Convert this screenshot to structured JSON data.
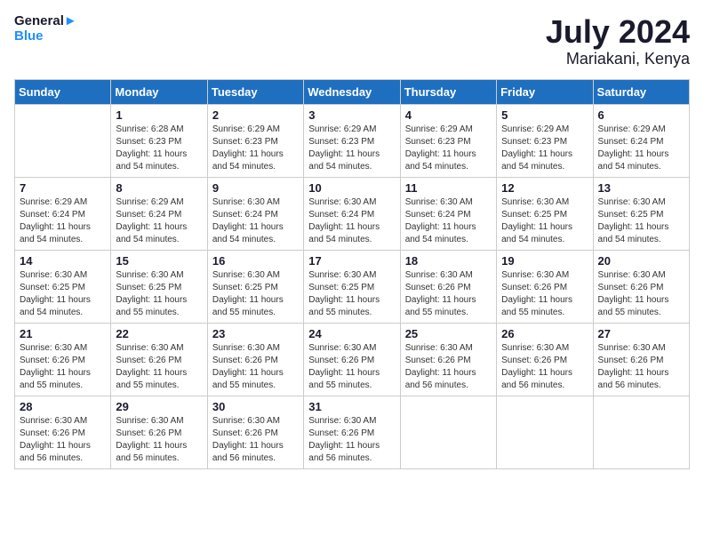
{
  "header": {
    "logo_general": "General",
    "logo_blue": "Blue",
    "month": "July 2024",
    "location": "Mariakani, Kenya"
  },
  "days_of_week": [
    "Sunday",
    "Monday",
    "Tuesday",
    "Wednesday",
    "Thursday",
    "Friday",
    "Saturday"
  ],
  "weeks": [
    [
      {
        "day": "",
        "sunrise": "",
        "sunset": "",
        "daylight": ""
      },
      {
        "day": "1",
        "sunrise": "Sunrise: 6:28 AM",
        "sunset": "Sunset: 6:23 PM",
        "daylight": "Daylight: 11 hours and 54 minutes."
      },
      {
        "day": "2",
        "sunrise": "Sunrise: 6:29 AM",
        "sunset": "Sunset: 6:23 PM",
        "daylight": "Daylight: 11 hours and 54 minutes."
      },
      {
        "day": "3",
        "sunrise": "Sunrise: 6:29 AM",
        "sunset": "Sunset: 6:23 PM",
        "daylight": "Daylight: 11 hours and 54 minutes."
      },
      {
        "day": "4",
        "sunrise": "Sunrise: 6:29 AM",
        "sunset": "Sunset: 6:23 PM",
        "daylight": "Daylight: 11 hours and 54 minutes."
      },
      {
        "day": "5",
        "sunrise": "Sunrise: 6:29 AM",
        "sunset": "Sunset: 6:23 PM",
        "daylight": "Daylight: 11 hours and 54 minutes."
      },
      {
        "day": "6",
        "sunrise": "Sunrise: 6:29 AM",
        "sunset": "Sunset: 6:24 PM",
        "daylight": "Daylight: 11 hours and 54 minutes."
      }
    ],
    [
      {
        "day": "7",
        "sunrise": "Sunrise: 6:29 AM",
        "sunset": "Sunset: 6:24 PM",
        "daylight": "Daylight: 11 hours and 54 minutes."
      },
      {
        "day": "8",
        "sunrise": "Sunrise: 6:29 AM",
        "sunset": "Sunset: 6:24 PM",
        "daylight": "Daylight: 11 hours and 54 minutes."
      },
      {
        "day": "9",
        "sunrise": "Sunrise: 6:30 AM",
        "sunset": "Sunset: 6:24 PM",
        "daylight": "Daylight: 11 hours and 54 minutes."
      },
      {
        "day": "10",
        "sunrise": "Sunrise: 6:30 AM",
        "sunset": "Sunset: 6:24 PM",
        "daylight": "Daylight: 11 hours and 54 minutes."
      },
      {
        "day": "11",
        "sunrise": "Sunrise: 6:30 AM",
        "sunset": "Sunset: 6:24 PM",
        "daylight": "Daylight: 11 hours and 54 minutes."
      },
      {
        "day": "12",
        "sunrise": "Sunrise: 6:30 AM",
        "sunset": "Sunset: 6:25 PM",
        "daylight": "Daylight: 11 hours and 54 minutes."
      },
      {
        "day": "13",
        "sunrise": "Sunrise: 6:30 AM",
        "sunset": "Sunset: 6:25 PM",
        "daylight": "Daylight: 11 hours and 54 minutes."
      }
    ],
    [
      {
        "day": "14",
        "sunrise": "Sunrise: 6:30 AM",
        "sunset": "Sunset: 6:25 PM",
        "daylight": "Daylight: 11 hours and 54 minutes."
      },
      {
        "day": "15",
        "sunrise": "Sunrise: 6:30 AM",
        "sunset": "Sunset: 6:25 PM",
        "daylight": "Daylight: 11 hours and 55 minutes."
      },
      {
        "day": "16",
        "sunrise": "Sunrise: 6:30 AM",
        "sunset": "Sunset: 6:25 PM",
        "daylight": "Daylight: 11 hours and 55 minutes."
      },
      {
        "day": "17",
        "sunrise": "Sunrise: 6:30 AM",
        "sunset": "Sunset: 6:25 PM",
        "daylight": "Daylight: 11 hours and 55 minutes."
      },
      {
        "day": "18",
        "sunrise": "Sunrise: 6:30 AM",
        "sunset": "Sunset: 6:26 PM",
        "daylight": "Daylight: 11 hours and 55 minutes."
      },
      {
        "day": "19",
        "sunrise": "Sunrise: 6:30 AM",
        "sunset": "Sunset: 6:26 PM",
        "daylight": "Daylight: 11 hours and 55 minutes."
      },
      {
        "day": "20",
        "sunrise": "Sunrise: 6:30 AM",
        "sunset": "Sunset: 6:26 PM",
        "daylight": "Daylight: 11 hours and 55 minutes."
      }
    ],
    [
      {
        "day": "21",
        "sunrise": "Sunrise: 6:30 AM",
        "sunset": "Sunset: 6:26 PM",
        "daylight": "Daylight: 11 hours and 55 minutes."
      },
      {
        "day": "22",
        "sunrise": "Sunrise: 6:30 AM",
        "sunset": "Sunset: 6:26 PM",
        "daylight": "Daylight: 11 hours and 55 minutes."
      },
      {
        "day": "23",
        "sunrise": "Sunrise: 6:30 AM",
        "sunset": "Sunset: 6:26 PM",
        "daylight": "Daylight: 11 hours and 55 minutes."
      },
      {
        "day": "24",
        "sunrise": "Sunrise: 6:30 AM",
        "sunset": "Sunset: 6:26 PM",
        "daylight": "Daylight: 11 hours and 55 minutes."
      },
      {
        "day": "25",
        "sunrise": "Sunrise: 6:30 AM",
        "sunset": "Sunset: 6:26 PM",
        "daylight": "Daylight: 11 hours and 56 minutes."
      },
      {
        "day": "26",
        "sunrise": "Sunrise: 6:30 AM",
        "sunset": "Sunset: 6:26 PM",
        "daylight": "Daylight: 11 hours and 56 minutes."
      },
      {
        "day": "27",
        "sunrise": "Sunrise: 6:30 AM",
        "sunset": "Sunset: 6:26 PM",
        "daylight": "Daylight: 11 hours and 56 minutes."
      }
    ],
    [
      {
        "day": "28",
        "sunrise": "Sunrise: 6:30 AM",
        "sunset": "Sunset: 6:26 PM",
        "daylight": "Daylight: 11 hours and 56 minutes."
      },
      {
        "day": "29",
        "sunrise": "Sunrise: 6:30 AM",
        "sunset": "Sunset: 6:26 PM",
        "daylight": "Daylight: 11 hours and 56 minutes."
      },
      {
        "day": "30",
        "sunrise": "Sunrise: 6:30 AM",
        "sunset": "Sunset: 6:26 PM",
        "daylight": "Daylight: 11 hours and 56 minutes."
      },
      {
        "day": "31",
        "sunrise": "Sunrise: 6:30 AM",
        "sunset": "Sunset: 6:26 PM",
        "daylight": "Daylight: 11 hours and 56 minutes."
      },
      {
        "day": "",
        "sunrise": "",
        "sunset": "",
        "daylight": ""
      },
      {
        "day": "",
        "sunrise": "",
        "sunset": "",
        "daylight": ""
      },
      {
        "day": "",
        "sunrise": "",
        "sunset": "",
        "daylight": ""
      }
    ]
  ]
}
